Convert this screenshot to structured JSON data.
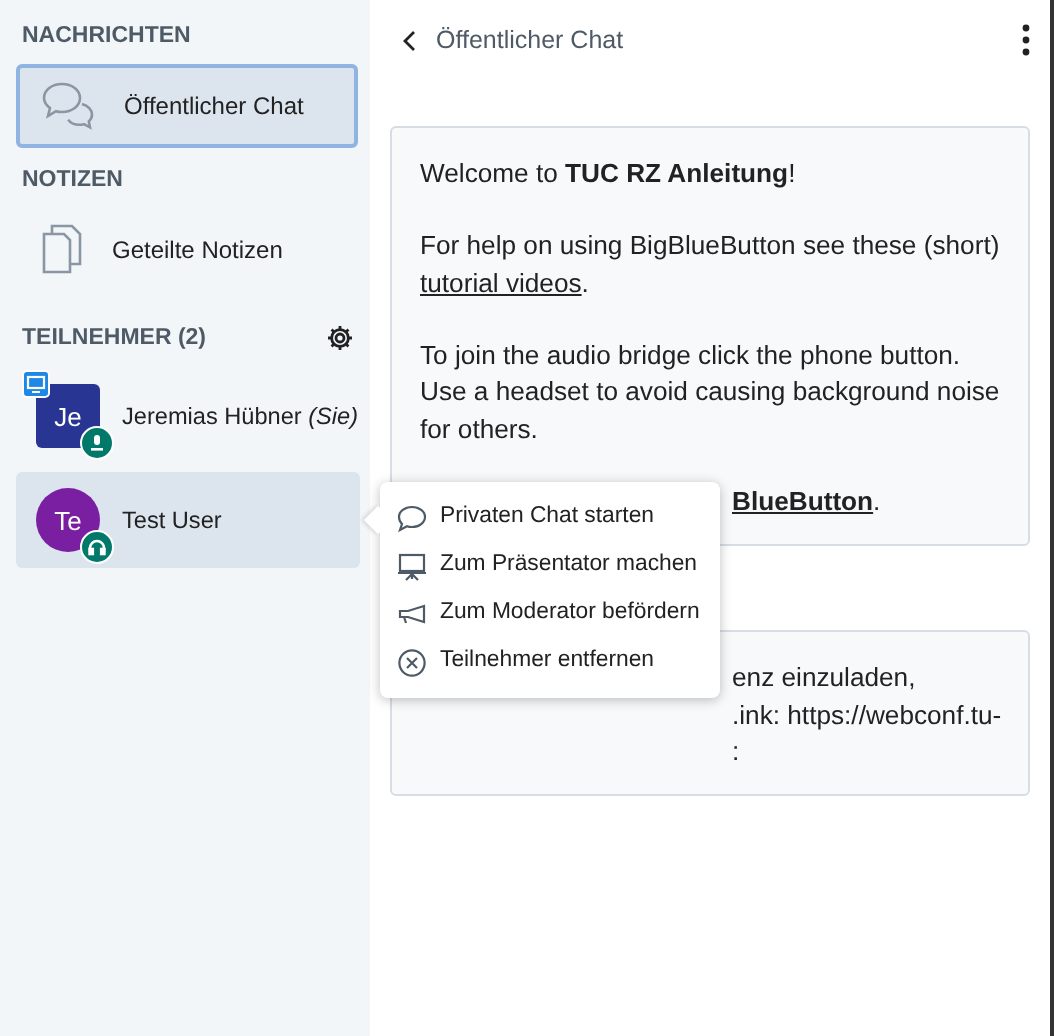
{
  "messages_section": {
    "title": "NACHRICHTEN",
    "items": [
      {
        "label": "Öffentlicher Chat",
        "selected": true
      }
    ]
  },
  "notes_section": {
    "title": "NOTIZEN",
    "items": [
      {
        "label": "Geteilte Notizen"
      }
    ]
  },
  "participants": {
    "title": "TEILNEHMER (2)",
    "users": [
      {
        "initials": "Je",
        "name": "Jeremias Hübner",
        "suffix": "(Sie)",
        "kind": "moderator",
        "color": "#283593",
        "presenter": true,
        "listen_only": false,
        "selected": false
      },
      {
        "initials": "Te",
        "name": "Test User",
        "kind": "viewer",
        "color": "#7b1fa2",
        "presenter": false,
        "listen_only": true,
        "selected": true
      }
    ]
  },
  "chat": {
    "title": "Öffentlicher Chat",
    "messages": [
      {
        "paragraphs": [
          {
            "text": "Welcome to **TUC RZ Anleitung**!"
          },
          {
            "segments": [
              {
                "text": "For help on using BigBlueButton see these (short) "
              },
              {
                "text": "tutorial videos",
                "link": true
              },
              {
                "text": "."
              }
            ]
          },
          {
            "text": "To join the audio bridge click the phone button. Use a headset to avoid causing background noise for others."
          },
          {
            "partial": true,
            "segments": [
              {
                "text": "**BlueButton**",
                "link": true
              },
              {
                "text": "."
              }
            ]
          }
        ]
      },
      {
        "paragraphs": [
          {
            "partial": true,
            "text": "enz einzuladen,"
          },
          {
            "partial": true,
            "text": ".ink: https://webconf.tu-"
          },
          {
            "partial": true,
            "text": ":"
          }
        ]
      }
    ]
  },
  "context_menu": {
    "items": [
      {
        "kind": "chat",
        "label": "Privaten Chat starten"
      },
      {
        "kind": "presenter",
        "label": "Zum Präsentator machen"
      },
      {
        "kind": "moderator",
        "label": "Zum Moderator befördern"
      },
      {
        "kind": "remove",
        "label": "Teilnehmer entfernen"
      }
    ]
  }
}
